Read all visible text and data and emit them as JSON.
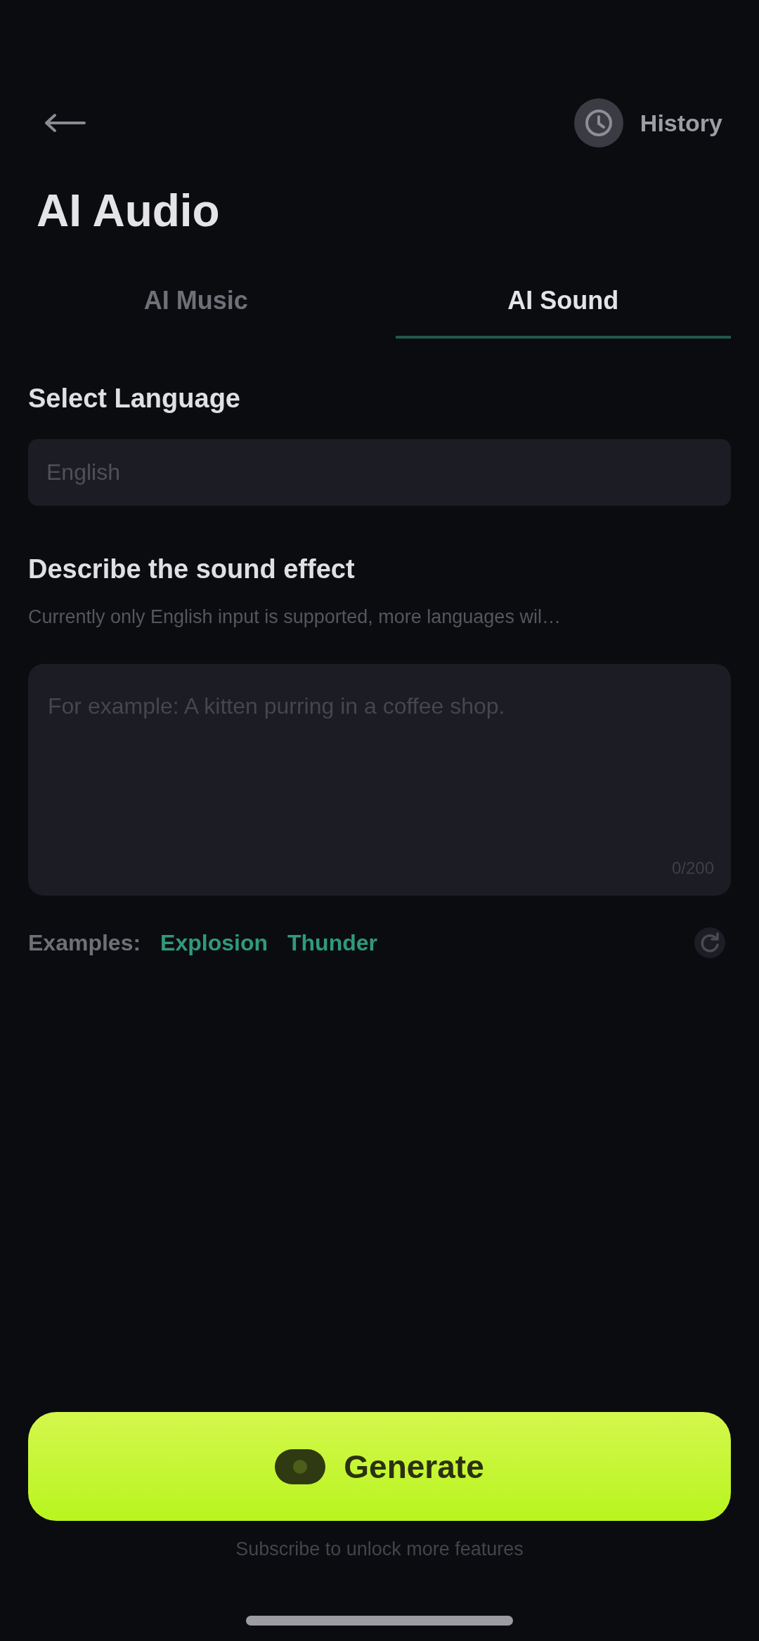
{
  "header": {
    "history_label": "History"
  },
  "title": "AI Audio",
  "tabs": [
    {
      "label": "AI Music",
      "selected": false
    },
    {
      "label": "AI Sound",
      "selected": true
    }
  ],
  "language": {
    "label": "Select Language",
    "value": "English"
  },
  "description": {
    "label": "Describe the sound effect",
    "hint": "Currently only English input is supported, more languages wil…",
    "placeholder": "For example: A kitten purring in a coffee shop.",
    "counter": "0/200"
  },
  "examples": {
    "label": "Examples:",
    "items": [
      "Explosion",
      "Thunder"
    ]
  },
  "generate_button": {
    "label": "Generate"
  },
  "footer_note": "Subscribe to unlock more features"
}
